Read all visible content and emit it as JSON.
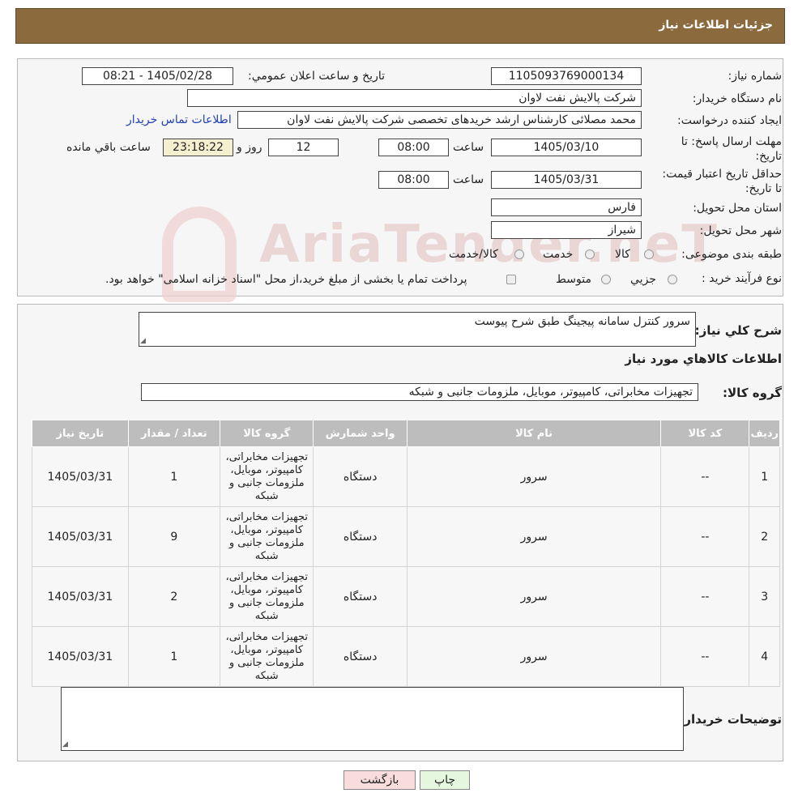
{
  "header": {
    "title": "جزئیات اطلاعات نیاز"
  },
  "watermark": {
    "text": "AriaTender.neT"
  },
  "form": {
    "need_number_label": "شماره نیاز:",
    "need_number": "1105093769000134",
    "announce_label": "تاریخ و ساعت اعلان عمومي:",
    "announce_value": "1405/02/28 - 08:21",
    "buyer_label": "نام دستگاه خریدار:",
    "buyer_value": "شرکت پالایش نفت لاوان",
    "creator_label": "ایجاد کننده درخواست:",
    "creator_value": "محمد مصلائی کارشناس ارشد خریدهای تخصصی شرکت پالایش نفت لاوان",
    "contact_link": "اطلاعات تماس خریدار",
    "deadline_label": "مهلت ارسال پاسخ: تا تاریخ:",
    "deadline_date": "1405/03/10",
    "time_label": "ساعت",
    "deadline_time": "08:00",
    "days_value": "12",
    "days_label": "روز و",
    "remaining_time": "23:18:22",
    "remaining_label": "ساعت باقي مانده",
    "validity_label": "حداقل تاریخ اعتبار قیمت: تا تاریخ:",
    "validity_date": "1405/03/31",
    "validity_time": "08:00",
    "province_label": "استان محل تحویل:",
    "province_value": "فارس",
    "city_label": "شهر محل تحویل:",
    "city_value": "شیراز",
    "category_label": "طبقه بندی موضوعی:",
    "category_options": [
      "کالا",
      "خدمت",
      "کالا/خدمت"
    ],
    "process_label": "نوع فرآیند خرید :",
    "process_options": [
      "جزیي",
      "متوسط"
    ],
    "process_note": "پرداخت تمام یا بخشی از مبلغ خرید،از محل \"اسناد خزانه اسلامی\" خواهد بود."
  },
  "description": {
    "label": "شرح کلي نیاز:",
    "value": "سرور کنترل سامانه پیجینگ طبق شرح پیوست"
  },
  "goods_section": {
    "title": "اطلاعات کالاهاي مورد نیاز",
    "group_label": "گروه کالا:",
    "group_value": "تجهیزات مخابراتی، کامپیوتر، موبایل، ملزومات جانبی و شبکه",
    "columns": [
      "ردیف",
      "کد کالا",
      "نام کالا",
      "واحد شمارش",
      "گروه کالا",
      "تعداد / مقدار",
      "تاریخ نیاز"
    ],
    "rows": [
      {
        "row": "1",
        "code": "--",
        "name": "سرور",
        "unit": "دستگاه",
        "group": "تجهیزات مخابراتی، کامپیوتر، موبایل، ملزومات جانبی و شبکه",
        "qty": "1",
        "date": "1405/03/31"
      },
      {
        "row": "2",
        "code": "--",
        "name": "سرور",
        "unit": "دستگاه",
        "group": "تجهیزات مخابراتی، کامپیوتر، موبایل، ملزومات جانبی و شبکه",
        "qty": "9",
        "date": "1405/03/31"
      },
      {
        "row": "3",
        "code": "--",
        "name": "سرور",
        "unit": "دستگاه",
        "group": "تجهیزات مخابراتی، کامپیوتر، موبایل، ملزومات جانبی و شبکه",
        "qty": "2",
        "date": "1405/03/31"
      },
      {
        "row": "4",
        "code": "--",
        "name": "سرور",
        "unit": "دستگاه",
        "group": "تجهیزات مخابراتی، کامپیوتر، موبایل، ملزومات جانبی و شبکه",
        "qty": "1",
        "date": "1405/03/31"
      }
    ],
    "buyer_notes_label": "توضیحات خریدار:",
    "buyer_notes_value": ""
  },
  "buttons": {
    "print": "چاپ",
    "back": "بازگشت"
  },
  "colors": {
    "header": "#8b6b3d",
    "print_button": "#e6f7df",
    "back_button": "#f9dcdc"
  }
}
